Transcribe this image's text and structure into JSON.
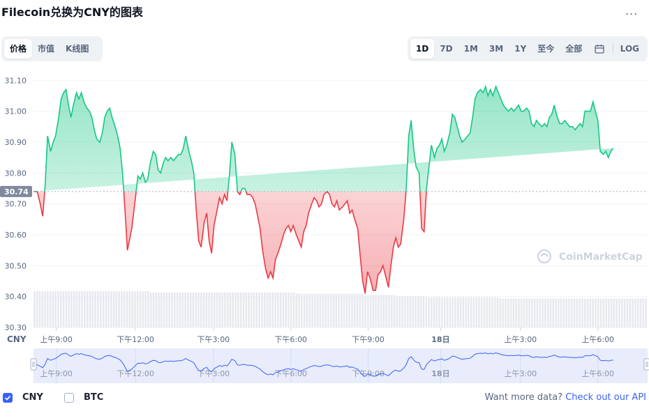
{
  "title": "Filecoin兑换为CNY的图表",
  "more_label": "...",
  "view_tabs": [
    {
      "label": "价格",
      "active": true
    },
    {
      "label": "市值",
      "active": false
    },
    {
      "label": "K线图",
      "active": false
    }
  ],
  "range_tabs": [
    {
      "label": "1D",
      "active": true
    },
    {
      "label": "7D",
      "active": false
    },
    {
      "label": "1M",
      "active": false
    },
    {
      "label": "3M",
      "active": false
    },
    {
      "label": "1Y",
      "active": false
    },
    {
      "label": "至今",
      "active": false
    },
    {
      "label": "全部",
      "active": false
    }
  ],
  "log_label": "LOG",
  "legend": [
    {
      "label": "CNY",
      "checked": true
    },
    {
      "label": "BTC",
      "checked": false
    }
  ],
  "footer": {
    "text": "Want more data?",
    "link": "Check out our API"
  },
  "colors": {
    "up": "#16c784",
    "down": "#ea3943",
    "navigator": "#3861fb"
  },
  "chart_data": {
    "type": "area",
    "currency_label": "CNY",
    "watermark": "CoinMarketCap",
    "baseline": 30.74,
    "baseline_label": "30.74",
    "ylim": [
      30.3,
      31.13
    ],
    "yticks": [
      "31.10",
      "31.00",
      "30.90",
      "30.80",
      "30.70",
      "30.60",
      "30.50",
      "30.40",
      "30.30"
    ],
    "yticks_values": [
      31.1,
      31.0,
      30.9,
      30.8,
      30.7,
      30.6,
      30.5,
      30.4,
      30.3
    ],
    "xlim": [
      0,
      1
    ],
    "xticks": [
      "上午9:00",
      "下午12:00",
      "下午3:00",
      "下午6:00",
      "下午9:00",
      "18日",
      "上午3:00",
      "上午6:00"
    ],
    "xticks_values": [
      0.037,
      0.166,
      0.293,
      0.419,
      0.545,
      0.663,
      0.793,
      0.919
    ],
    "x": [
      0.0,
      0.006,
      0.011,
      0.015,
      0.019,
      0.023,
      0.028,
      0.032,
      0.036,
      0.041,
      0.045,
      0.049,
      0.053,
      0.057,
      0.061,
      0.065,
      0.07,
      0.074,
      0.078,
      0.082,
      0.087,
      0.091,
      0.095,
      0.099,
      0.103,
      0.108,
      0.112,
      0.116,
      0.12,
      0.124,
      0.128,
      0.133,
      0.137,
      0.141,
      0.145,
      0.149,
      0.153,
      0.16,
      0.166,
      0.17,
      0.174,
      0.178,
      0.182,
      0.186,
      0.19,
      0.195,
      0.199,
      0.203,
      0.207,
      0.211,
      0.215,
      0.219,
      0.224,
      0.228,
      0.232,
      0.236,
      0.24,
      0.244,
      0.248,
      0.253,
      0.257,
      0.261,
      0.265,
      0.269,
      0.273,
      0.278,
      0.282,
      0.286,
      0.29,
      0.294,
      0.298,
      0.303,
      0.307,
      0.311,
      0.315,
      0.319,
      0.323,
      0.328,
      0.332,
      0.336,
      0.34,
      0.344,
      0.348,
      0.353,
      0.357,
      0.361,
      0.365,
      0.369,
      0.373,
      0.378,
      0.382,
      0.386,
      0.39,
      0.394,
      0.398,
      0.403,
      0.407,
      0.411,
      0.415,
      0.419,
      0.423,
      0.428,
      0.432,
      0.436,
      0.44,
      0.444,
      0.448,
      0.453,
      0.457,
      0.461,
      0.465,
      0.469,
      0.473,
      0.478,
      0.482,
      0.486,
      0.49,
      0.494,
      0.498,
      0.503,
      0.507,
      0.511,
      0.515,
      0.519,
      0.523,
      0.528,
      0.532,
      0.536,
      0.54,
      0.544,
      0.548,
      0.553,
      0.557,
      0.561,
      0.565,
      0.569,
      0.573,
      0.578,
      0.582,
      0.586,
      0.59,
      0.594,
      0.598,
      0.603,
      0.607,
      0.611,
      0.615,
      0.619,
      0.623,
      0.628,
      0.632,
      0.636,
      0.64,
      0.644,
      0.648,
      0.653,
      0.657,
      0.661,
      0.665,
      0.669,
      0.673,
      0.678,
      0.682,
      0.686,
      0.69,
      0.694,
      0.698,
      0.703,
      0.707,
      0.711,
      0.715,
      0.719,
      0.723,
      0.728,
      0.732,
      0.736,
      0.74,
      0.744,
      0.748,
      0.753,
      0.757,
      0.761,
      0.765,
      0.769,
      0.773,
      0.778,
      0.782,
      0.786,
      0.79,
      0.794,
      0.798,
      0.803,
      0.807,
      0.811,
      0.815,
      0.819,
      0.823,
      0.828,
      0.832,
      0.836,
      0.84,
      0.844,
      0.848,
      0.853,
      0.857,
      0.861,
      0.865,
      0.869,
      0.873,
      0.878,
      0.882,
      0.886,
      0.89,
      0.894,
      0.898,
      0.903,
      0.907,
      0.911,
      0.915,
      0.919,
      0.923,
      0.928,
      0.932,
      0.936,
      0.94,
      0.944,
      0.948,
      0.953,
      0.957,
      0.961,
      0.965,
      0.969,
      0.973,
      0.978,
      0.982,
      0.986,
      0.99,
      0.994,
      1.0
    ],
    "y": [
      30.74,
      30.74,
      30.7,
      30.66,
      30.76,
      30.92,
      30.87,
      30.9,
      30.92,
      30.98,
      31.04,
      31.06,
      31.07,
      31.02,
      30.98,
      31.02,
      31.06,
      31.04,
      31.06,
      31.03,
      31.01,
      31.0,
      30.98,
      30.94,
      30.91,
      30.9,
      30.93,
      30.98,
      31.0,
      31.01,
      30.98,
      30.95,
      30.92,
      30.88,
      30.8,
      30.68,
      30.55,
      30.62,
      30.72,
      30.79,
      30.78,
      30.8,
      30.77,
      30.78,
      30.83,
      30.87,
      30.86,
      30.81,
      30.8,
      30.83,
      30.85,
      30.84,
      30.85,
      30.84,
      30.85,
      30.86,
      30.86,
      30.88,
      30.92,
      30.87,
      30.84,
      30.8,
      30.68,
      30.58,
      30.56,
      30.64,
      30.67,
      30.58,
      30.54,
      30.63,
      30.67,
      30.72,
      30.7,
      30.73,
      30.71,
      30.79,
      30.9,
      30.86,
      30.74,
      30.73,
      30.75,
      30.75,
      30.73,
      30.73,
      30.72,
      30.7,
      30.66,
      30.62,
      30.55,
      30.49,
      30.46,
      30.48,
      30.46,
      30.52,
      30.54,
      30.57,
      30.6,
      30.62,
      30.63,
      30.61,
      30.63,
      30.6,
      30.58,
      30.56,
      30.61,
      30.63,
      30.67,
      30.7,
      30.72,
      30.71,
      30.69,
      30.7,
      30.73,
      30.74,
      30.73,
      30.7,
      30.69,
      30.71,
      30.68,
      30.69,
      30.7,
      30.71,
      30.67,
      30.68,
      30.65,
      30.62,
      30.53,
      30.45,
      30.41,
      30.48,
      30.46,
      30.42,
      30.42,
      30.47,
      30.48,
      30.5,
      30.47,
      30.43,
      30.5,
      30.56,
      30.59,
      30.56,
      30.57,
      30.65,
      30.75,
      30.92,
      30.97,
      30.88,
      30.82,
      30.8,
      30.62,
      30.61,
      30.75,
      30.82,
      30.89,
      30.85,
      30.88,
      30.89,
      30.91,
      30.87,
      30.89,
      30.93,
      30.99,
      30.98,
      30.95,
      30.92,
      30.9,
      30.91,
      30.92,
      30.93,
      30.98,
      31.04,
      31.06,
      31.07,
      31.06,
      31.08,
      31.05,
      31.07,
      31.05,
      31.08,
      31.06,
      31.04,
      31.02,
      31.01,
      31.0,
      31.01,
      31.0,
      31.01,
      31.02,
      31.0,
      31.0,
      31.01,
      31.0,
      30.96,
      30.95,
      30.97,
      30.96,
      30.95,
      30.96,
      30.95,
      30.98,
      30.99,
      31.02,
      30.98,
      30.96,
      30.96,
      30.97,
      30.96,
      30.95,
      30.95,
      30.94,
      30.95,
      30.96,
      30.95,
      31.0,
      31.0,
      31.0,
      31.03,
      31.0,
      30.97,
      30.87,
      30.86,
      30.87,
      30.85,
      30.87,
      30.88
    ],
    "volume": [
      0.3,
      0.3,
      0.3,
      0.3,
      0.3,
      0.3,
      0.3,
      0.3,
      0.3,
      0.3,
      0.3,
      0.3,
      0.3,
      0.3,
      0.3,
      0.3,
      0.3,
      0.3,
      0.3,
      0.3,
      0.3,
      0.3,
      0.3,
      0.3,
      0.3,
      0.3,
      0.3,
      0.3,
      0.3,
      0.3,
      0.3,
      0.3,
      0.3,
      0.3,
      0.3,
      0.3,
      0.3,
      0.3,
      0.3,
      0.3,
      0.3,
      0.3,
      0.3,
      0.3,
      0.29,
      0.29,
      0.29,
      0.29,
      0.29,
      0.29,
      0.29,
      0.29,
      0.29,
      0.29,
      0.29,
      0.29,
      0.29,
      0.29,
      0.29,
      0.29,
      0.29,
      0.29,
      0.29,
      0.29,
      0.29,
      0.29,
      0.29,
      0.29,
      0.29,
      0.29,
      0.29,
      0.29,
      0.29,
      0.29,
      0.29,
      0.29,
      0.29,
      0.29,
      0.29,
      0.29,
      0.29,
      0.29,
      0.29,
      0.29,
      0.29,
      0.29,
      0.29,
      0.29,
      0.29,
      0.29,
      0.29,
      0.29,
      0.29,
      0.29,
      0.29,
      0.29,
      0.29,
      0.29,
      0.29,
      0.28,
      0.28,
      0.28,
      0.28,
      0.28,
      0.28,
      0.28,
      0.28,
      0.28,
      0.28,
      0.28,
      0.28,
      0.28,
      0.28,
      0.28,
      0.28,
      0.28,
      0.28,
      0.28,
      0.28,
      0.28,
      0.28,
      0.28,
      0.28,
      0.28,
      0.28,
      0.28,
      0.27,
      0.27,
      0.27,
      0.27,
      0.27,
      0.27,
      0.27,
      0.27,
      0.27,
      0.27,
      0.27,
      0.26,
      0.26,
      0.26,
      0.26,
      0.26,
      0.26,
      0.26,
      0.26,
      0.26,
      0.26,
      0.26,
      0.25,
      0.25,
      0.25,
      0.25,
      0.25,
      0.25,
      0.25,
      0.25,
      0.25,
      0.25,
      0.25,
      0.25,
      0.25,
      0.25,
      0.25,
      0.25,
      0.25,
      0.25,
      0.25,
      0.25,
      0.25,
      0.25,
      0.25,
      0.25,
      0.25,
      0.25,
      0.25,
      0.25,
      0.24,
      0.24,
      0.24,
      0.24,
      0.24,
      0.24,
      0.24,
      0.24,
      0.24,
      0.24,
      0.24,
      0.24,
      0.24,
      0.24,
      0.24,
      0.24,
      0.24,
      0.24,
      0.24,
      0.24,
      0.24,
      0.24,
      0.24,
      0.24,
      0.24,
      0.24,
      0.24,
      0.24,
      0.24,
      0.24,
      0.24,
      0.24,
      0.24,
      0.24,
      0.24,
      0.24,
      0.24,
      0.24,
      0.24,
      0.24,
      0.24,
      0.24,
      0.24,
      0.24,
      0.24,
      0.24,
      0.24,
      0.24,
      0.24,
      0.24,
      0.24,
      0.24,
      0.24,
      0.24,
      0.24,
      0.24
    ]
  }
}
